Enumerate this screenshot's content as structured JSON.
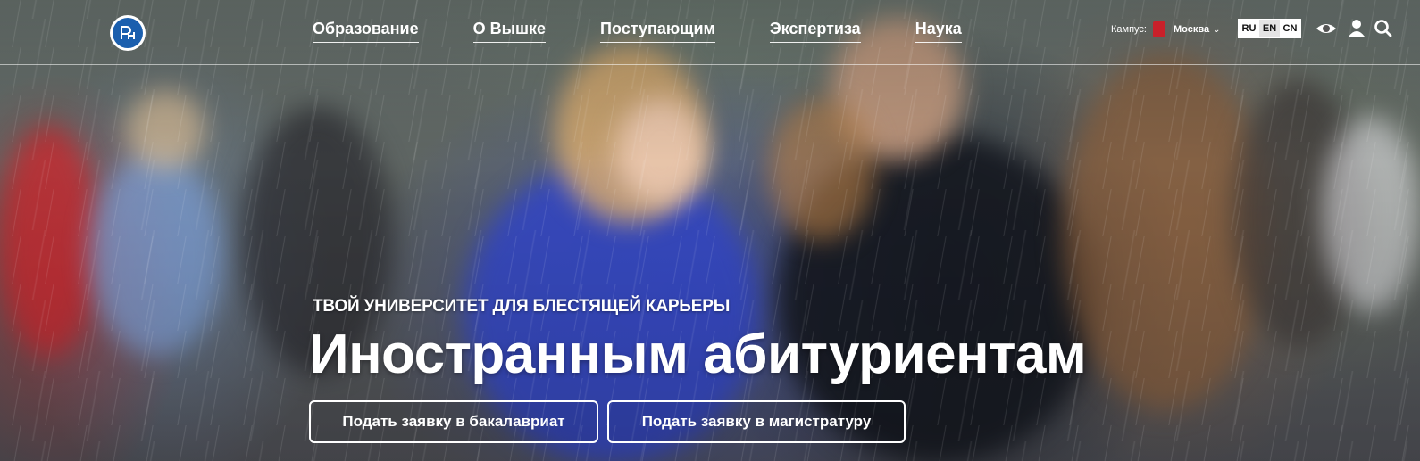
{
  "header": {
    "nav": [
      {
        "label": "Образование"
      },
      {
        "label": "О Вышке"
      },
      {
        "label": "Поступающим"
      },
      {
        "label": "Экспертиза"
      },
      {
        "label": "Наука"
      }
    ],
    "campus_label": "Кампус:",
    "campus_city": "Москва",
    "languages": [
      "RU",
      "EN",
      "CN"
    ],
    "icons": [
      "visually-impaired-eye-icon",
      "user-profile-icon",
      "search-icon"
    ]
  },
  "hero": {
    "subtitle": "ТВОЙ УНИВЕРСИТЕТ ДЛЯ БЛЕСТЯЩЕЙ КАРЬЕРЫ",
    "title": "Иностранным абитуриентам",
    "buttons": [
      {
        "label": "Подать заявку в бакалавриат"
      },
      {
        "label": "Подать заявку в магистратуру"
      }
    ]
  },
  "colors": {
    "brand_blue": "#1b5fae",
    "campus_flag_red": "#c8202a",
    "text": "#ffffff"
  }
}
